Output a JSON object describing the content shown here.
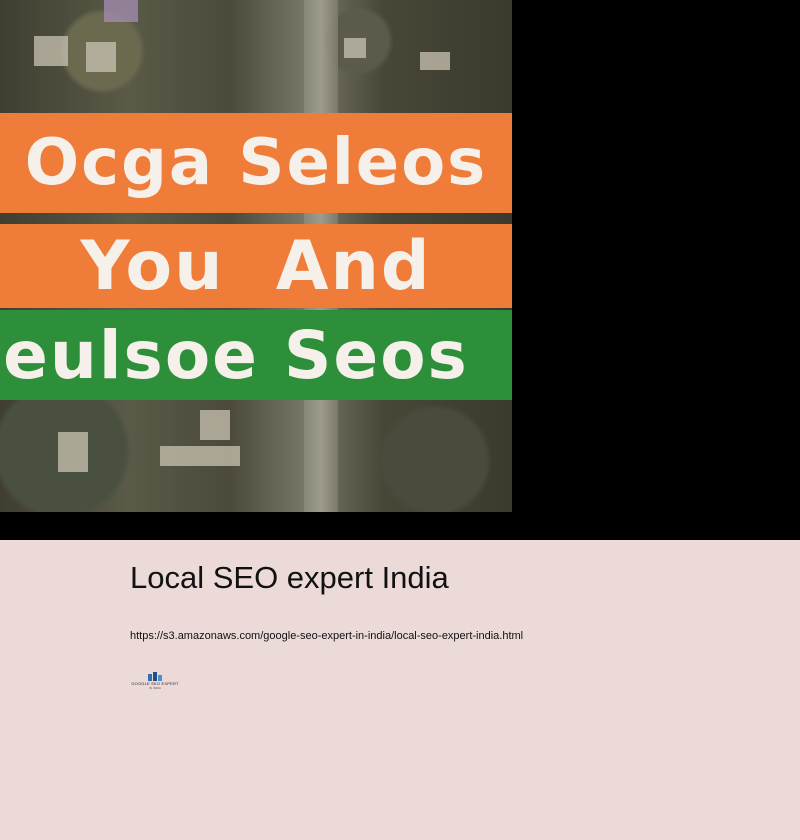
{
  "hero": {
    "banner_line1": "Ocga Seleos",
    "banner_line2": "You  And",
    "banner_line3": "eulsoe Seos",
    "colors": {
      "orange": "#f07c3a",
      "green": "#2e8f3a",
      "background": "#000000"
    }
  },
  "article": {
    "title": "Local SEO expert India",
    "url": "https://s3.amazonaws.com/google-seo-expert-in-india/local-seo-expert-india.html"
  },
  "logo": {
    "icon": "logo-mark-icon",
    "text": "GOOGLE SEO EXPERT",
    "subtext": "IN INDIA"
  },
  "page": {
    "background": "#ecdad9"
  }
}
